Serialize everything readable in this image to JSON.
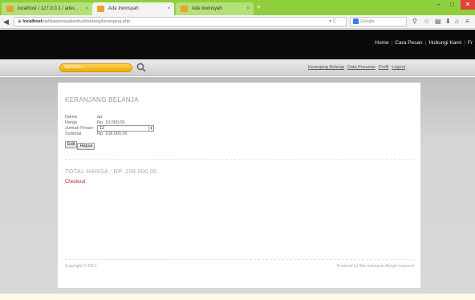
{
  "browser": {
    "tabs": [
      {
        "title": "localhost / 127.0.0.1 / adei...",
        "color": "#e8a13a"
      },
      {
        "title": "Ade Irwinsyah",
        "color": "#f0a030"
      },
      {
        "title": "Ade Irwinsyah",
        "color": "#f0a030"
      }
    ],
    "new_tab": "+",
    "minimize": "–",
    "maximize": "□",
    "close": "✕",
    "url_host": "localhost",
    "url_path": "/aplikasipenjualanbuahbarang/keranjang.php",
    "search_placeholder": "Google"
  },
  "site": {
    "nav": [
      "Home",
      "Cara Pesan",
      "Hubungi Kami",
      "Fr"
    ],
    "search_placeholder": "SEARCH",
    "user_nav": [
      "Keranjang Belanja",
      "Data Pesanan",
      "Profil",
      "Logout"
    ]
  },
  "cart": {
    "title": "KERANJANG BELANJA",
    "fields": [
      {
        "label": "Nama",
        "value": "aa"
      },
      {
        "label": "Harga",
        "value": "Rp. 10.000,00"
      },
      {
        "label": "Jumlah Pesan",
        "value": "12"
      },
      {
        "label": "Subtotal",
        "value": "Rp. 108.000,00"
      }
    ],
    "edit_label": "Edit",
    "delete_label": "Hapus",
    "total": "TOTAL HARGA : RP. 108.000,00",
    "checkout": "Checkout"
  },
  "footer": {
    "copyright": "Copyright © 2012.",
    "powered": "Powered by Ade Irwinsyah Allright reserved"
  },
  "colors": {
    "tabbar": "#8fcf3e",
    "search_accent": "#f0a800",
    "checkout": "#b22222"
  }
}
